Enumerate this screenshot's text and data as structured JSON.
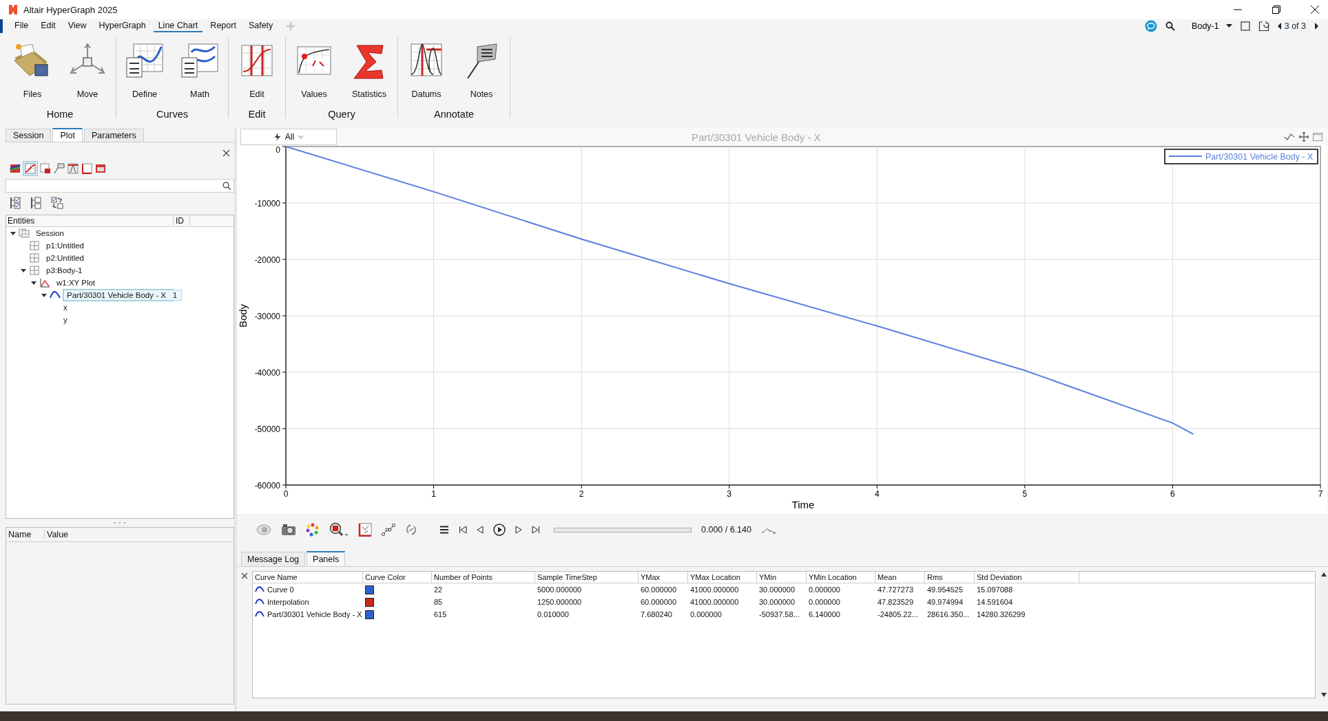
{
  "window": {
    "title": "Altair HyperGraph 2025"
  },
  "menu": [
    {
      "label": "File",
      "selected": false
    },
    {
      "label": "Edit",
      "selected": false
    },
    {
      "label": "View",
      "selected": false
    },
    {
      "label": "HyperGraph",
      "selected": false
    },
    {
      "label": "Line Chart",
      "selected": true
    },
    {
      "label": "Report",
      "selected": false
    },
    {
      "label": "Safety",
      "selected": false
    }
  ],
  "top_bar": {
    "page_selector": "Body-1",
    "page_counter": "3 of 3"
  },
  "ribbon": {
    "groups": [
      {
        "title": "Home",
        "tools": [
          {
            "label": "Files",
            "kind": "files"
          },
          {
            "label": "Move",
            "kind": "move"
          }
        ]
      },
      {
        "title": "Curves",
        "tools": [
          {
            "label": "Define",
            "kind": "define"
          },
          {
            "label": "Math",
            "kind": "math"
          }
        ]
      },
      {
        "title": "Edit",
        "tools": [
          {
            "label": "Edit",
            "kind": "edit"
          }
        ]
      },
      {
        "title": "Query",
        "tools": [
          {
            "label": "Values",
            "kind": "values"
          },
          {
            "label": "Statistics",
            "kind": "statistics"
          }
        ]
      },
      {
        "title": "Annotate",
        "tools": [
          {
            "label": "Datums",
            "kind": "datums"
          },
          {
            "label": "Notes",
            "kind": "notes"
          }
        ]
      }
    ]
  },
  "left_panel": {
    "tabs": [
      {
        "label": "Session",
        "selected": false
      },
      {
        "label": "Plot",
        "selected": true
      },
      {
        "label": "Parameters",
        "selected": false
      }
    ],
    "tree_columns": [
      "Entities",
      "ID"
    ],
    "tree": [
      {
        "label": "Session",
        "kind": "session",
        "expanded": true,
        "selected": false,
        "children": [
          {
            "label": "p1:Untitled",
            "kind": "page",
            "selected": false
          },
          {
            "label": "p2:Untitled",
            "kind": "page",
            "selected": false
          },
          {
            "label": "p3:Body-1",
            "kind": "page",
            "expanded": true,
            "selected": false,
            "children": [
              {
                "label": "w1:XY Plot",
                "kind": "plot",
                "expanded": true,
                "selected": false,
                "children": [
                  {
                    "label": "Part/30301 Vehicle Body - X",
                    "kind": "curve",
                    "id": "1",
                    "expanded": true,
                    "selected": true,
                    "children": [
                      {
                        "label": "x",
                        "selected": false
                      },
                      {
                        "label": "y",
                        "selected": false
                      }
                    ]
                  }
                ]
              }
            ]
          }
        ]
      }
    ],
    "properties_columns": [
      "Name",
      "Value"
    ]
  },
  "plot": {
    "filter": "All",
    "title": "Part/30301 Vehicle Body - X",
    "chart_data": {
      "type": "line",
      "grid": true,
      "xlabel": "Time",
      "ylabel": "Body",
      "x": [
        0,
        1,
        2,
        3,
        4,
        5,
        6,
        6.14
      ],
      "series": [
        {
          "name": "Part/30301 Vehicle Body - X",
          "color": "#5b7fe0",
          "values": [
            0,
            -8000,
            -16400,
            -24300,
            -31800,
            -39700,
            -49000,
            -51000
          ]
        }
      ],
      "xlim": [
        0,
        7
      ],
      "ylim": [
        -60000,
        0
      ],
      "xticks": [
        0,
        1,
        2,
        3,
        4,
        5,
        6,
        7
      ],
      "yticks": [
        0,
        -10000,
        -20000,
        -30000,
        -40000,
        -50000,
        -60000
      ]
    }
  },
  "playback": {
    "time": "0.000 / 6.140",
    "level": 0
  },
  "bottom_panel": {
    "tabs": [
      {
        "label": "Message Log",
        "selected": false
      },
      {
        "label": "Panels",
        "selected": true
      }
    ],
    "columns": [
      "Curve Name",
      "Curve Color",
      "Number of Points",
      "Sample TimeStep",
      "YMax",
      "YMax Location",
      "YMin",
      "YMin Location",
      "Mean",
      "Rms",
      "Std Deviation"
    ],
    "rows": [
      {
        "color": "#2e5fd0",
        "cells": [
          "Curve 0",
          "",
          "22",
          "5000.000000",
          "60.000000",
          "41000.000000",
          "30.000000",
          "0.000000",
          "47.727273",
          "49.954525",
          "15.097088"
        ]
      },
      {
        "color": "#cc2a1a",
        "cells": [
          "Interpolation",
          "",
          "85",
          "1250.000000",
          "60.000000",
          "41000.000000",
          "30.000000",
          "0.000000",
          "47.823529",
          "49.974994",
          "14.591604"
        ]
      },
      {
        "color": "#2e5fd0",
        "cells": [
          "Part/30301 Vehicle Body - X",
          "",
          "615",
          "0.010000",
          "7.680240",
          "0.000000",
          "-50937.58...",
          "6.140000",
          "-24805.22...",
          "28616.350...",
          "14280.326299"
        ]
      }
    ]
  }
}
